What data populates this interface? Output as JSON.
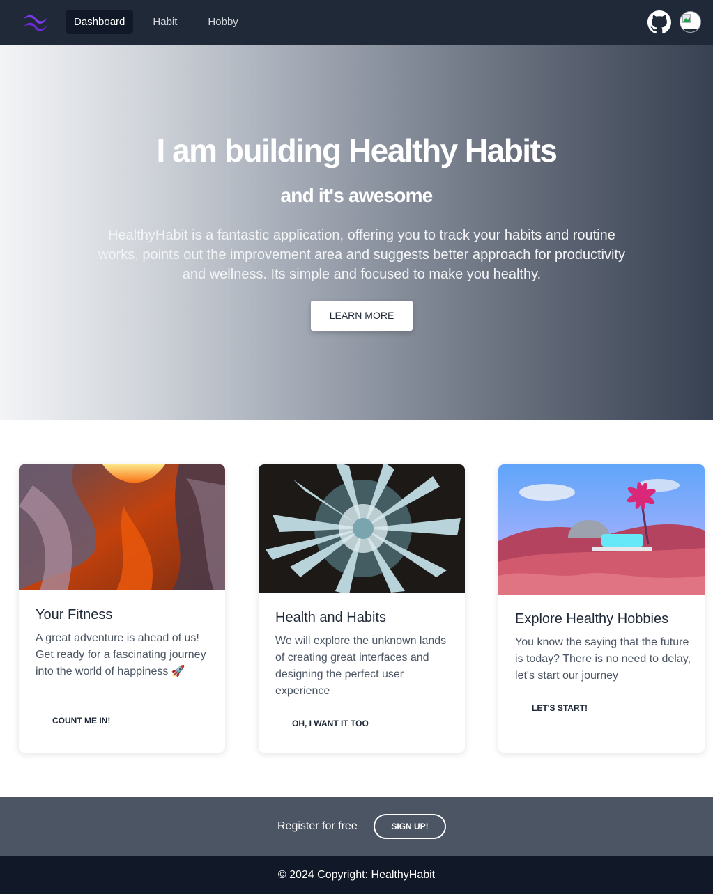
{
  "nav": {
    "links": [
      {
        "label": "Dashboard",
        "active": true
      },
      {
        "label": "Habit",
        "active": false
      },
      {
        "label": "Hobby",
        "active": false
      }
    ],
    "icons": [
      "logo-icon",
      "github-icon",
      "avatar"
    ],
    "logo_color": "#7c3aed"
  },
  "hero": {
    "title": "I am building Healthy Habits",
    "subtitle": "and it's awesome",
    "description": "HealthyHabit is a fantastic application, offering you to track your habits and routine works, points out the improvement area and suggests better approach for productivity and wellness. Its simple and focused to make you healthy.",
    "button": "LEARN MORE"
  },
  "cards": [
    {
      "title": "Your Fitness",
      "text": "A great adventure is ahead of us! Get ready for a fascinating journey into the world of happiness 🚀",
      "button": "COUNT ME IN!",
      "image": "canyon-image"
    },
    {
      "title": "Health and Habits",
      "text": "We will explore the unknown lands of creating great interfaces and designing the perfect user experience",
      "button": "OH, I WANT IT TOO",
      "image": "abstract-burst-image"
    },
    {
      "title": "Explore Healthy Hobbies",
      "text": "You know the saying that the future is today? There is no need to delay, let's start our journey",
      "button": "LET'S START!",
      "image": "palm-landscape-image"
    }
  ],
  "footer": {
    "register_text": "Register for free",
    "signup_button": "SIGN UP!",
    "copyright": "© 2024 Copyright: HealthyHabit"
  }
}
